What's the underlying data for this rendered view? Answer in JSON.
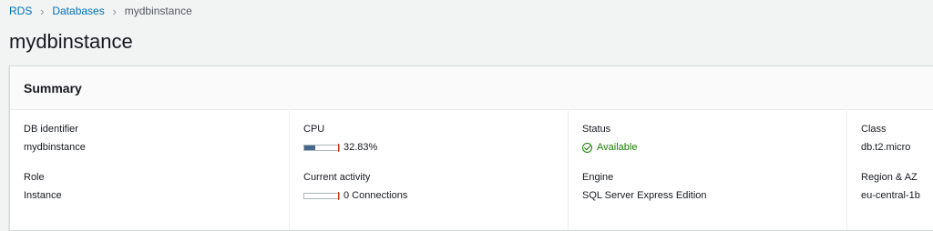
{
  "breadcrumb": {
    "items": [
      "RDS",
      "Databases",
      "mydbinstance"
    ]
  },
  "page": {
    "title": "mydbinstance"
  },
  "summary": {
    "title": "Summary",
    "db_identifier": {
      "label": "DB identifier",
      "value": "mydbinstance"
    },
    "role": {
      "label": "Role",
      "value": "Instance"
    },
    "cpu": {
      "label": "CPU",
      "value": "32.83%",
      "fraction": 0.3283
    },
    "current_activity": {
      "label": "Current activity",
      "value": "0 Connections",
      "fraction": 0
    },
    "status": {
      "label": "Status",
      "value": "Available",
      "color": "#1d8102",
      "icon": "check-circle-icon"
    },
    "engine": {
      "label": "Engine",
      "value": "SQL Server Express Edition"
    },
    "class": {
      "label": "Class",
      "value": "db.t2.micro"
    },
    "region_az": {
      "label": "Region & AZ",
      "value": "eu-central-1b"
    }
  },
  "colors": {
    "link": "#0073bb",
    "meter_fill": "#44678b",
    "meter_limit": "#d13212"
  }
}
